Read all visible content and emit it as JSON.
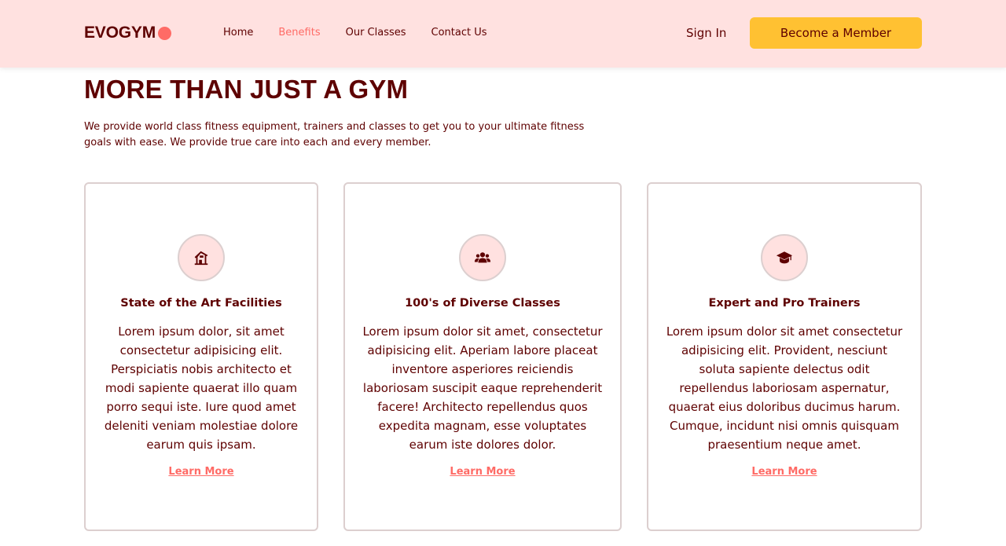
{
  "navbar": {
    "logo_text": "EVOGYM",
    "links": [
      {
        "label": "Home"
      },
      {
        "label": "Benefits",
        "active": true
      },
      {
        "label": "Our Classes"
      },
      {
        "label": "Contact Us"
      }
    ],
    "sign_in": "Sign In",
    "cta": "Become a Member"
  },
  "section": {
    "title": "MORE THAN JUST A GYM",
    "intro": "We provide world class fitness equipment, trainers and classes to get you to your ultimate fitness goals with ease. We provide true care into each and every member."
  },
  "cards": [
    {
      "icon": "home-modern-icon",
      "title": "State of the Art Facilities",
      "text": "Lorem ipsum dolor, sit amet consectetur adipisicing elit. Perspiciatis nobis architecto et modi sapiente quaerat illo quam porro sequi iste. Iure quod amet deleniti veniam molestiae dolore earum quis ipsam.",
      "link": "Learn More"
    },
    {
      "icon": "user-group-icon",
      "title": "100's of Diverse Classes",
      "text": "Lorem ipsum dolor sit amet, consectetur adipisicing elit. Aperiam labore placeat inventore asperiores reiciendis laboriosam suscipit eaque reprehenderit facere! Architecto repellendus quos expedita magnam, esse voluptates earum iste dolores dolor.",
      "link": "Learn More"
    },
    {
      "icon": "academic-cap-icon",
      "title": "Expert and Pro Trainers",
      "text": "Lorem ipsum dolor sit amet consectetur adipisicing elit. Provident, nesciunt soluta sapiente delectus odit repellendus laboriosam aspernatur, quaerat eius doloribus ducimus harum. Cumque, incidunt nisi omnis quisquam praesentium neque amet.",
      "link": "Learn More"
    }
  ],
  "colors": {
    "primary": "#5e0000",
    "nav_bg": "#ffe1e0",
    "accent": "#ff6b66",
    "cta_bg": "#ffc132",
    "card_border": "#dccfcf"
  }
}
